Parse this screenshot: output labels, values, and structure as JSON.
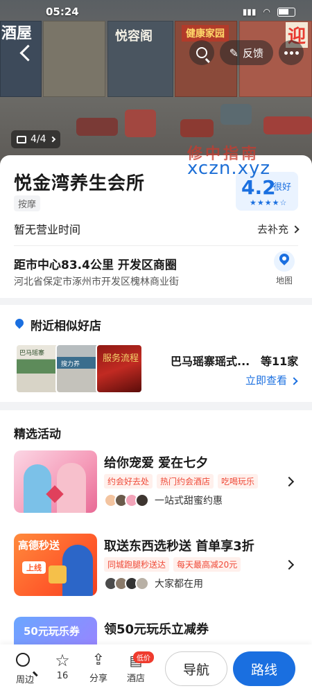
{
  "status_bar": {
    "time": "05:24"
  },
  "hero": {
    "signs": [
      "酒屋",
      "悦容阁",
      "健康家园",
      "迎"
    ],
    "photo_index": "4/4",
    "watermark_cn": "修中指南",
    "watermark_url": "xczn.xyz"
  },
  "header": {
    "feedback_label": "反馈"
  },
  "shop": {
    "name": "悦金湾养生会所",
    "category": "按摩",
    "rating": "4.2",
    "rating_label": "很好",
    "stars": "★★★★☆",
    "hours": "暂无营业时间",
    "hours_link": "去补充",
    "distance": "距市中心83.4公里  开发区商圈",
    "address": "河北省保定市涿州市开发区槐林商业街",
    "map_label": "地图"
  },
  "nearby": {
    "title": "附近相似好店",
    "thumb_texts": [
      "巴马瑶寨",
      "搜力养",
      "服务流程"
    ],
    "name": "巴马瑶寨瑶式...",
    "count": "等11家",
    "link": "立即查看"
  },
  "activities": {
    "title": "精选活动",
    "items": [
      {
        "title": "给你宠爱 爱在七夕",
        "tags": [
          "约会好去处",
          "热门约会酒店",
          "吃喝玩乐"
        ],
        "sub": "一站式甜蜜约惠"
      },
      {
        "title": "取送东西选秒送 首单享3折",
        "tags": [
          "同城跑腿秒送达",
          "每天最高减20元"
        ],
        "sub": "大家都在用",
        "img_title": "高德秒送",
        "img_chip": "上线"
      },
      {
        "title": "领50元玩乐立减券",
        "img_title": "50元玩乐券"
      }
    ]
  },
  "bottom_bar": {
    "items": [
      "周边",
      "16",
      "分享",
      "酒店"
    ],
    "badge": "低价",
    "nav_label": "导航",
    "route_label": "路线"
  },
  "colors": {
    "accent": "#1a6fe0",
    "tag_red": "#ef4a38"
  }
}
